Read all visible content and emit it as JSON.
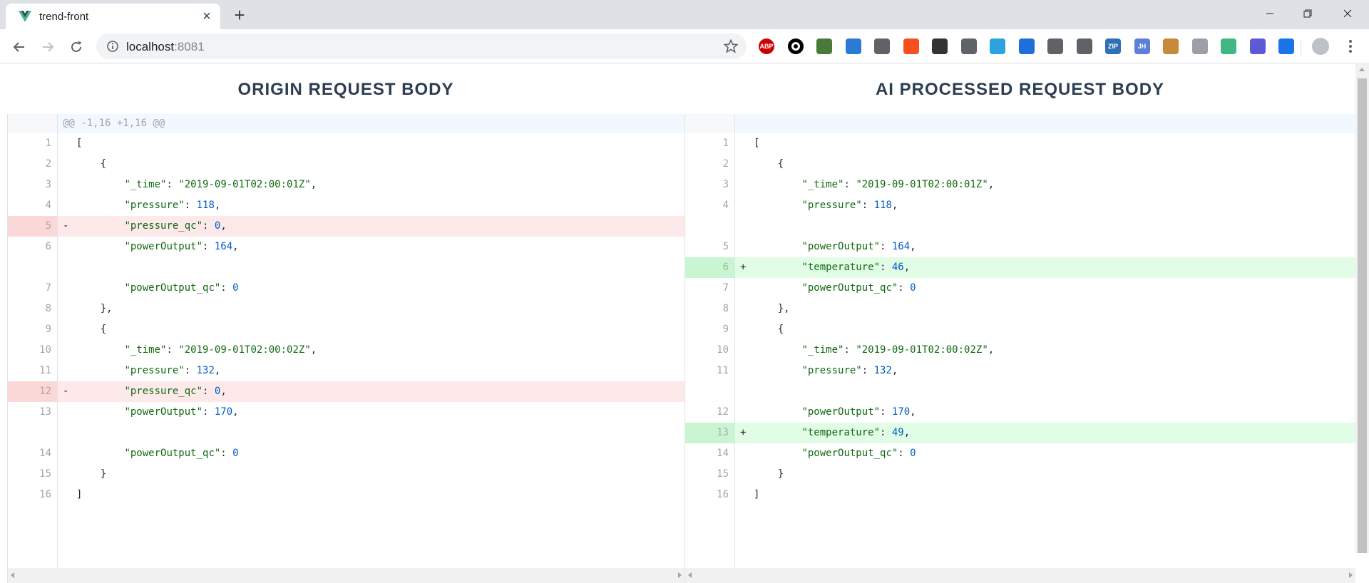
{
  "browser": {
    "tab_title": "trend-front",
    "url_host": "localhost",
    "url_port": ":8081",
    "extensions": [
      {
        "name": "adblock-plus-icon",
        "label": "ABP",
        "color": "#cc0000"
      },
      {
        "name": "circle-extension-icon",
        "label": "",
        "color": "#000000"
      },
      {
        "name": "magnifier-extension-icon",
        "label": "",
        "color": "#4a7a3a"
      },
      {
        "name": "globe-extension-icon",
        "label": "",
        "color": "#2b7bd6"
      },
      {
        "name": "code-extension-icon",
        "label": "",
        "color": "#5f6368"
      },
      {
        "name": "translate-extension-icon",
        "label": "",
        "color": "#f4511e"
      },
      {
        "name": "qr-code-extension-icon",
        "label": "",
        "color": "#333333"
      },
      {
        "name": "history-extension-icon",
        "label": "",
        "color": "#5f6368"
      },
      {
        "name": "telegram-extension-icon",
        "label": "",
        "color": "#2aa3df"
      },
      {
        "name": "eye-extension-icon",
        "label": "",
        "color": "#1e6fd9"
      },
      {
        "name": "recycle-extension-icon",
        "label": "",
        "color": "#5f6368"
      },
      {
        "name": "block-extension-icon",
        "label": "",
        "color": "#5f6368"
      },
      {
        "name": "zip-extension-icon",
        "label": "ZIP",
        "color": "#2f6fb5"
      },
      {
        "name": "jh-extension-icon",
        "label": "JH",
        "color": "#5c7fd9"
      },
      {
        "name": "cookie-extension-icon",
        "label": "",
        "color": "#c88a3a"
      },
      {
        "name": "lock-extension-icon",
        "label": "",
        "color": "#9aa0a6"
      },
      {
        "name": "vue-devtools-icon",
        "label": "",
        "color": "#41b883"
      },
      {
        "name": "web-extension-icon",
        "label": "",
        "color": "#5b5bd6"
      },
      {
        "name": "window-extension-icon",
        "label": "",
        "color": "#1a73e8"
      }
    ]
  },
  "page": {
    "left_title": "ORIGIN REQUEST BODY",
    "right_title": "AI PROCESSED REQUEST BODY",
    "hunk_header": "@@ -1,16 +1,16 @@"
  },
  "left_lines": [
    {
      "num": "1",
      "sign": "",
      "type": "ctx",
      "indent": "",
      "key": "",
      "value": "",
      "vtype": "",
      "tail": "["
    },
    {
      "num": "2",
      "sign": "",
      "type": "ctx",
      "indent": "    ",
      "key": "",
      "value": "",
      "vtype": "",
      "tail": "{"
    },
    {
      "num": "3",
      "sign": "",
      "type": "ctx",
      "indent": "        ",
      "key": "\"_time\"",
      "value": "\"2019-09-01T02:00:01Z\"",
      "vtype": "s",
      "tail": ","
    },
    {
      "num": "4",
      "sign": "",
      "type": "ctx",
      "indent": "        ",
      "key": "\"pressure\"",
      "value": "118",
      "vtype": "n",
      "tail": ","
    },
    {
      "num": "5",
      "sign": "-",
      "type": "del",
      "indent": "        ",
      "key": "\"pressure_qc\"",
      "value": "0",
      "vtype": "n",
      "tail": ","
    },
    {
      "num": "6",
      "sign": "",
      "type": "ctx",
      "indent": "        ",
      "key": "\"powerOutput\"",
      "value": "164",
      "vtype": "n",
      "tail": ","
    },
    {
      "num": "",
      "sign": "",
      "type": "empty",
      "indent": "",
      "key": "",
      "value": "",
      "vtype": "",
      "tail": ""
    },
    {
      "num": "7",
      "sign": "",
      "type": "ctx",
      "indent": "        ",
      "key": "\"powerOutput_qc\"",
      "value": "0",
      "vtype": "n",
      "tail": ""
    },
    {
      "num": "8",
      "sign": "",
      "type": "ctx",
      "indent": "    ",
      "key": "",
      "value": "",
      "vtype": "",
      "tail": "},"
    },
    {
      "num": "9",
      "sign": "",
      "type": "ctx",
      "indent": "    ",
      "key": "",
      "value": "",
      "vtype": "",
      "tail": "{"
    },
    {
      "num": "10",
      "sign": "",
      "type": "ctx",
      "indent": "        ",
      "key": "\"_time\"",
      "value": "\"2019-09-01T02:00:02Z\"",
      "vtype": "s",
      "tail": ","
    },
    {
      "num": "11",
      "sign": "",
      "type": "ctx",
      "indent": "        ",
      "key": "\"pressure\"",
      "value": "132",
      "vtype": "n",
      "tail": ","
    },
    {
      "num": "12",
      "sign": "-",
      "type": "del",
      "indent": "        ",
      "key": "\"pressure_qc\"",
      "value": "0",
      "vtype": "n",
      "tail": ","
    },
    {
      "num": "13",
      "sign": "",
      "type": "ctx",
      "indent": "        ",
      "key": "\"powerOutput\"",
      "value": "170",
      "vtype": "n",
      "tail": ","
    },
    {
      "num": "",
      "sign": "",
      "type": "empty",
      "indent": "",
      "key": "",
      "value": "",
      "vtype": "",
      "tail": ""
    },
    {
      "num": "14",
      "sign": "",
      "type": "ctx",
      "indent": "        ",
      "key": "\"powerOutput_qc\"",
      "value": "0",
      "vtype": "n",
      "tail": ""
    },
    {
      "num": "15",
      "sign": "",
      "type": "ctx",
      "indent": "    ",
      "key": "",
      "value": "",
      "vtype": "",
      "tail": "}"
    },
    {
      "num": "16",
      "sign": "",
      "type": "ctx",
      "indent": "",
      "key": "",
      "value": "",
      "vtype": "",
      "tail": "]"
    }
  ],
  "right_lines": [
    {
      "num": "1",
      "sign": "",
      "type": "ctx",
      "indent": "",
      "key": "",
      "value": "",
      "vtype": "",
      "tail": "["
    },
    {
      "num": "2",
      "sign": "",
      "type": "ctx",
      "indent": "    ",
      "key": "",
      "value": "",
      "vtype": "",
      "tail": "{"
    },
    {
      "num": "3",
      "sign": "",
      "type": "ctx",
      "indent": "        ",
      "key": "\"_time\"",
      "value": "\"2019-09-01T02:00:01Z\"",
      "vtype": "s",
      "tail": ","
    },
    {
      "num": "4",
      "sign": "",
      "type": "ctx",
      "indent": "        ",
      "key": "\"pressure\"",
      "value": "118",
      "vtype": "n",
      "tail": ","
    },
    {
      "num": "",
      "sign": "",
      "type": "empty",
      "indent": "",
      "key": "",
      "value": "",
      "vtype": "",
      "tail": ""
    },
    {
      "num": "5",
      "sign": "",
      "type": "ctx",
      "indent": "        ",
      "key": "\"powerOutput\"",
      "value": "164",
      "vtype": "n",
      "tail": ","
    },
    {
      "num": "6",
      "sign": "+",
      "type": "add",
      "indent": "        ",
      "key": "\"temperature\"",
      "value": "46",
      "vtype": "n",
      "tail": ","
    },
    {
      "num": "7",
      "sign": "",
      "type": "ctx",
      "indent": "        ",
      "key": "\"powerOutput_qc\"",
      "value": "0",
      "vtype": "n",
      "tail": ""
    },
    {
      "num": "8",
      "sign": "",
      "type": "ctx",
      "indent": "    ",
      "key": "",
      "value": "",
      "vtype": "",
      "tail": "},"
    },
    {
      "num": "9",
      "sign": "",
      "type": "ctx",
      "indent": "    ",
      "key": "",
      "value": "",
      "vtype": "",
      "tail": "{"
    },
    {
      "num": "10",
      "sign": "",
      "type": "ctx",
      "indent": "        ",
      "key": "\"_time\"",
      "value": "\"2019-09-01T02:00:02Z\"",
      "vtype": "s",
      "tail": ","
    },
    {
      "num": "11",
      "sign": "",
      "type": "ctx",
      "indent": "        ",
      "key": "\"pressure\"",
      "value": "132",
      "vtype": "n",
      "tail": ","
    },
    {
      "num": "",
      "sign": "",
      "type": "empty",
      "indent": "",
      "key": "",
      "value": "",
      "vtype": "",
      "tail": ""
    },
    {
      "num": "12",
      "sign": "",
      "type": "ctx",
      "indent": "        ",
      "key": "\"powerOutput\"",
      "value": "170",
      "vtype": "n",
      "tail": ","
    },
    {
      "num": "13",
      "sign": "+",
      "type": "add",
      "indent": "        ",
      "key": "\"temperature\"",
      "value": "49",
      "vtype": "n",
      "tail": ","
    },
    {
      "num": "14",
      "sign": "",
      "type": "ctx",
      "indent": "        ",
      "key": "\"powerOutput_qc\"",
      "value": "0",
      "vtype": "n",
      "tail": ""
    },
    {
      "num": "15",
      "sign": "",
      "type": "ctx",
      "indent": "    ",
      "key": "",
      "value": "",
      "vtype": "",
      "tail": "}"
    },
    {
      "num": "16",
      "sign": "",
      "type": "ctx",
      "indent": "",
      "key": "",
      "value": "",
      "vtype": "",
      "tail": "]"
    }
  ]
}
